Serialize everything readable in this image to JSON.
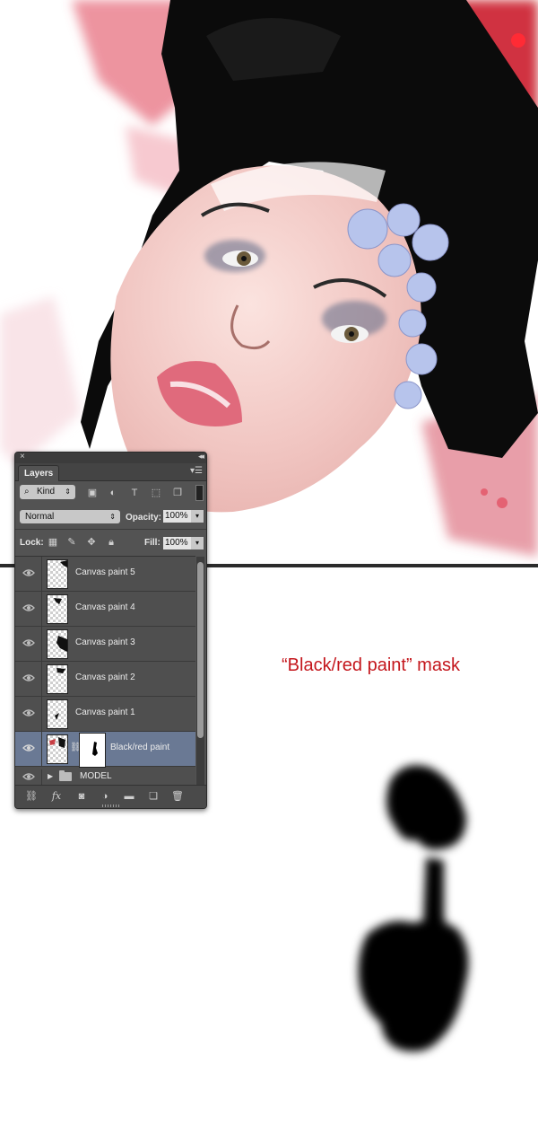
{
  "panel": {
    "tab_label": "Layers",
    "filter": {
      "kind_label": "Kind"
    },
    "blend_mode": "Normal",
    "opacity_label": "Opacity:",
    "opacity_value": "100%",
    "lock_label": "Lock:",
    "fill_label": "Fill:",
    "fill_value": "100%",
    "layers": [
      {
        "name": "Canvas paint 5",
        "visible": true
      },
      {
        "name": "Canvas paint 4",
        "visible": true
      },
      {
        "name": "Canvas paint 3",
        "visible": true
      },
      {
        "name": "Canvas paint 2",
        "visible": true
      },
      {
        "name": "Canvas paint 1",
        "visible": true
      },
      {
        "name": "Black/red paint",
        "visible": true,
        "selected": true,
        "has_mask": true
      }
    ],
    "group": {
      "name": "MODEL",
      "collapsed": true
    }
  },
  "caption": "“Black/red paint” mask",
  "colors": {
    "caption": "#c4161c",
    "selected_row": "#6a7994",
    "panel_bg": "#535353"
  }
}
